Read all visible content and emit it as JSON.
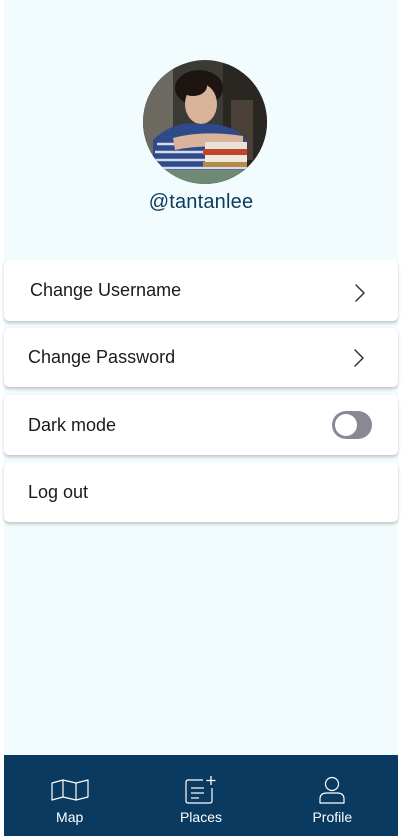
{
  "profile": {
    "username": "@tantanlee",
    "avatar_icon": "user-photo"
  },
  "settings": {
    "change_username": {
      "label": "Change Username",
      "icon": "chevron-right-icon"
    },
    "change_password": {
      "label": "Change Password",
      "icon": "chevron-right-icon"
    },
    "dark_mode": {
      "label": "Dark mode",
      "enabled": false
    },
    "log_out": {
      "label": "Log out"
    }
  },
  "bottom_nav": {
    "items": [
      {
        "label": "Map",
        "icon": "map-icon"
      },
      {
        "label": "Places",
        "icon": "places-add-icon"
      },
      {
        "label": "Profile",
        "icon": "profile-icon"
      }
    ]
  },
  "colors": {
    "background": "#f2fbfd",
    "nav_background": "#0a3a60",
    "username_text": "#0b3a5e",
    "toggle_off": "#8b8896"
  }
}
